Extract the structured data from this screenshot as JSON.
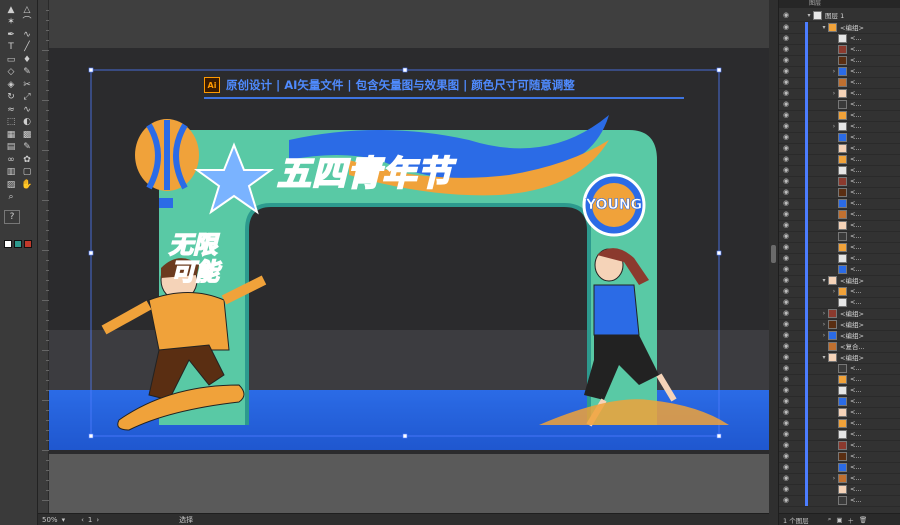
{
  "toolbar": {
    "tools": [
      "selection-tool",
      "direct-selection-tool",
      "magic-wand-tool",
      "lasso-tool",
      "pen-tool",
      "curvature-tool",
      "type-tool",
      "line-tool",
      "rectangle-tool",
      "paintbrush-tool",
      "shaper-tool",
      "pencil-tool",
      "eraser-tool",
      "scissors-tool",
      "rotate-tool",
      "scale-tool",
      "width-tool",
      "warp-tool",
      "free-transform-tool",
      "shape-builder-tool",
      "perspective-grid-tool",
      "mesh-tool",
      "gradient-tool",
      "eyedropper-tool",
      "blend-tool",
      "symbol-sprayer-tool",
      "column-graph-tool",
      "artboard-tool",
      "slice-tool",
      "hand-tool",
      "zoom-tool"
    ],
    "help_label": "?"
  },
  "canvas": {
    "banner_text": "原创设计 | AI矢量文件 | 包含矢量图与效果图 | 颜色尺寸可随意调整",
    "ai_badge": "Ai",
    "arch_title": "五四青年节",
    "side_text_line1": "无限",
    "side_text_line2": "可能",
    "badge_text": "YOUNG",
    "colors": {
      "arch_green": "#59c9a5",
      "arch_teal": "#2d9a8e",
      "title_teal": "#0f6b63",
      "accent_blue": "#2b6be6",
      "accent_orange": "#f0a23a"
    }
  },
  "statusbar": {
    "zoom": "50%",
    "artboard_number": "1",
    "tool_status": "选择"
  },
  "layers_panel": {
    "header": "图层",
    "top_layer": "图层 1",
    "rows": [
      {
        "label": "<编组>",
        "arrow": "▾"
      },
      {
        "label": "<...",
        "arrow": ""
      },
      {
        "label": "<...",
        "arrow": ""
      },
      {
        "label": "<...",
        "arrow": ""
      },
      {
        "label": "<...",
        "arrow": "›"
      },
      {
        "label": "<...",
        "arrow": ""
      },
      {
        "label": "<...",
        "arrow": "›"
      },
      {
        "label": "<...",
        "arrow": ""
      },
      {
        "label": "<...",
        "arrow": ""
      },
      {
        "label": "<...",
        "arrow": "›"
      },
      {
        "label": "<...",
        "arrow": ""
      },
      {
        "label": "<...",
        "arrow": ""
      },
      {
        "label": "<...",
        "arrow": ""
      },
      {
        "label": "<...",
        "arrow": ""
      },
      {
        "label": "<...",
        "arrow": ""
      },
      {
        "label": "<...",
        "arrow": ""
      },
      {
        "label": "<...",
        "arrow": ""
      },
      {
        "label": "<...",
        "arrow": ""
      },
      {
        "label": "<...",
        "arrow": ""
      },
      {
        "label": "<...",
        "arrow": ""
      },
      {
        "label": "<...",
        "arrow": ""
      },
      {
        "label": "<...",
        "arrow": ""
      },
      {
        "label": "<...",
        "arrow": ""
      },
      {
        "label": "<编组>",
        "arrow": "▾"
      },
      {
        "label": "<...",
        "arrow": "›"
      },
      {
        "label": "<...",
        "arrow": ""
      },
      {
        "label": "<编组>",
        "arrow": "›"
      },
      {
        "label": "<编组>",
        "arrow": "›"
      },
      {
        "label": "<编组>",
        "arrow": "›"
      },
      {
        "label": "<复合...",
        "arrow": ""
      },
      {
        "label": "<编组>",
        "arrow": "▾"
      },
      {
        "label": "<...",
        "arrow": ""
      },
      {
        "label": "<...",
        "arrow": ""
      },
      {
        "label": "<...",
        "arrow": ""
      },
      {
        "label": "<...",
        "arrow": ""
      },
      {
        "label": "<...",
        "arrow": ""
      },
      {
        "label": "<...",
        "arrow": ""
      },
      {
        "label": "<...",
        "arrow": ""
      },
      {
        "label": "<...",
        "arrow": ""
      },
      {
        "label": "<...",
        "arrow": ""
      },
      {
        "label": "<...",
        "arrow": ""
      },
      {
        "label": "<...",
        "arrow": "›"
      },
      {
        "label": "<...",
        "arrow": ""
      },
      {
        "label": "<...",
        "arrow": ""
      }
    ],
    "footer_count": "1 个图层"
  }
}
